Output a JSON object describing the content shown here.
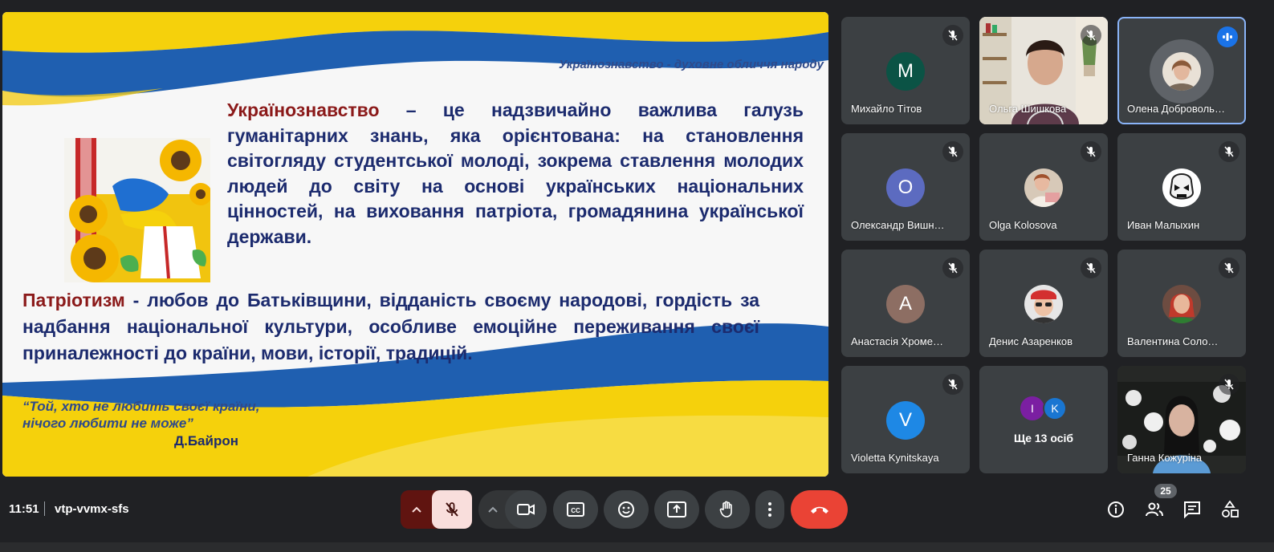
{
  "slide": {
    "header": "Українознавство -  духовне обличчя народу",
    "para1_term": "Українознавство",
    "para1_text": " – це надзвичайно важлива галузь гуманітарних знань, яка орієнтована: на становлення світогляду студентської молоді, зокрема ставлення молодих людей до світу на основі українських національних цінностей, на виховання патріота, громадянина української держави.",
    "para2_term": "Патріотизм",
    "para2_text": " - любов до Батьківщини, відданість своєму народові, гордість за надбання національної культури, особливе емоційне переживання своєї приналежності до країни, мови, історії, традицій.",
    "quote_line1": "“Той, хто не любить своєї країни,",
    "quote_line2": "нічого любити не може”",
    "author": "Д.Байрон",
    "colors": {
      "blue": "#1f5fb0",
      "yellow": "#f5d10c",
      "term": "#8b1a1a",
      "text": "#1c2b6e"
    }
  },
  "participants": [
    {
      "name": "Михайло Тітов",
      "initial": "M",
      "avatar_color": "#0b5345",
      "muted": true,
      "type": "initial"
    },
    {
      "name": "Ольга Шишкова",
      "muted": true,
      "type": "video"
    },
    {
      "name": "Олена Доброволь…",
      "muted": false,
      "speaking": true,
      "type": "photo-ring"
    },
    {
      "name": "Олександр Вишн…",
      "initial": "О",
      "avatar_color": "#5c6bc0",
      "muted": true,
      "type": "initial"
    },
    {
      "name": "Olga Kolosova",
      "muted": true,
      "type": "photo"
    },
    {
      "name": "Иван Малыхин",
      "muted": true,
      "type": "photo"
    },
    {
      "name": "Анастасія Хроме…",
      "initial": "А",
      "avatar_color": "#8d6e63",
      "muted": true,
      "type": "initial"
    },
    {
      "name": "Денис Азаренков",
      "muted": true,
      "type": "photo"
    },
    {
      "name": "Валентина Соло…",
      "muted": true,
      "type": "photo"
    },
    {
      "name": "Violetta Kynitskaya",
      "initial": "V",
      "avatar_color": "#1e88e5",
      "muted": true,
      "type": "initial"
    },
    {
      "name": "Ще 13 осіб",
      "others": [
        "I",
        "K"
      ],
      "type": "others"
    },
    {
      "name": "Ганна Кожуріна",
      "muted": true,
      "type": "video"
    }
  ],
  "bottom": {
    "time": "11:51",
    "meeting_code": "vtp-vvmx-sfs",
    "people_count": "25"
  }
}
